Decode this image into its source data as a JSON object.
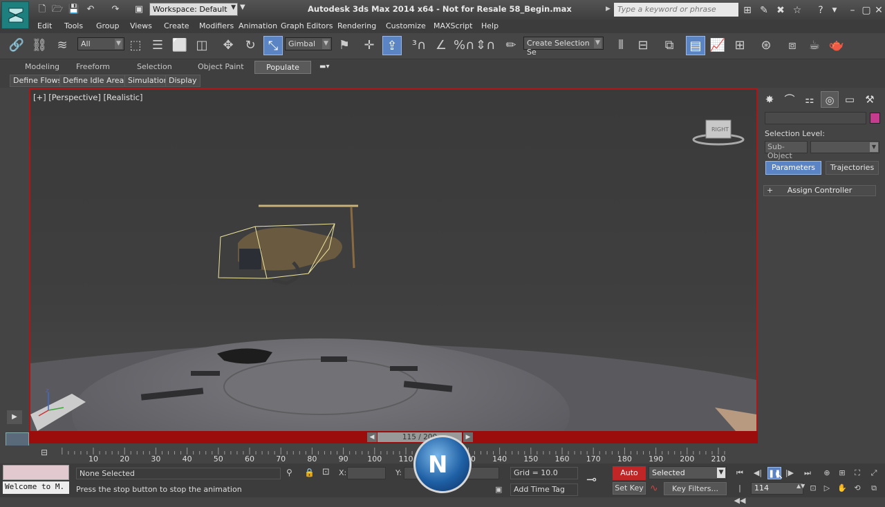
{
  "title_bar": {
    "workspace": "Workspace: Default",
    "title": "Autodesk 3ds Max  2014 x64  - Not for Resale   58_Begin.max",
    "search_placeholder": "Type a keyword or phrase"
  },
  "menu": [
    "Edit",
    "Tools",
    "Group",
    "Views",
    "Create",
    "Modifiers",
    "Animation",
    "Graph Editors",
    "Rendering",
    "Customize",
    "MAXScript",
    "Help"
  ],
  "toolbar": {
    "selection_filter": "All",
    "ref_coord": "Gimbal",
    "named_selection_placeholder": "Create Selection Se"
  },
  "ribbon_tabs": [
    "Modeling",
    "Freeform",
    "Selection",
    "Object Paint",
    "Populate"
  ],
  "populate_buttons": [
    "Define Flows",
    "Define Idle Areas",
    "Simulation",
    "Display"
  ],
  "viewport": {
    "label": "[+] [Perspective] [Realistic]"
  },
  "time_slider": {
    "frame": "115 / 200"
  },
  "track_ticks": [
    "10",
    "20",
    "30",
    "40",
    "50",
    "60",
    "70",
    "80",
    "90",
    "100",
    "110",
    "120",
    "130",
    "140",
    "150",
    "160",
    "170",
    "180",
    "190",
    "200",
    "210"
  ],
  "command_panel": {
    "selection_level": "Selection Level:",
    "sub_object": "Sub-Object",
    "parameters": "Parameters",
    "trajectories": "Trajectories",
    "assign_controller": "Assign Controller",
    "plus": "+"
  },
  "status": {
    "maxscript": "Welcome to M.",
    "selection": "None Selected",
    "prompt": "Press the stop button to stop the animation",
    "x_label": "X:",
    "y_label": "Y:",
    "z_label": "Z:",
    "grid": "Grid = 10.0",
    "add_time_tag": "Add Time Tag",
    "auto_key": "Auto Key",
    "set_key": "Set Key",
    "key_set": "Selected",
    "key_filters": "Key Filters...",
    "current_frame": "114"
  },
  "viewcube_label": "RIGHT",
  "colors": {
    "accent": "#5b84c4",
    "auto_key": "#c02626",
    "viewport_border": "#b01414",
    "object_color": "#c53c8e"
  }
}
